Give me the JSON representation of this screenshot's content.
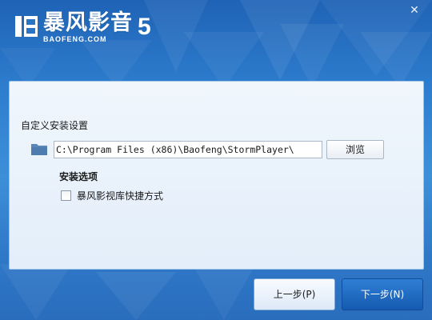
{
  "window": {
    "close_glyph": "✕"
  },
  "logo": {
    "cn_text": "暴风影音",
    "en_text": "BAOFENG.COM",
    "version_number": "5",
    "icon": "baofeng-logo-icon"
  },
  "install": {
    "section_title": "自定义安装设置",
    "path_value": "C:\\Program Files (x86)\\Baofeng\\StormPlayer\\",
    "folder_icon": "folder-icon",
    "browse_label": "浏览",
    "options_title": "安装选项",
    "shortcut_label": "暴风影视库快捷方式",
    "shortcut_checked": false
  },
  "footer": {
    "prev_label": "上一步(P)",
    "next_label": "下一步(N)"
  },
  "colors": {
    "accent": "#1f63b6",
    "panel_bg": "#e3eefa",
    "next_button": "#145ab0"
  }
}
